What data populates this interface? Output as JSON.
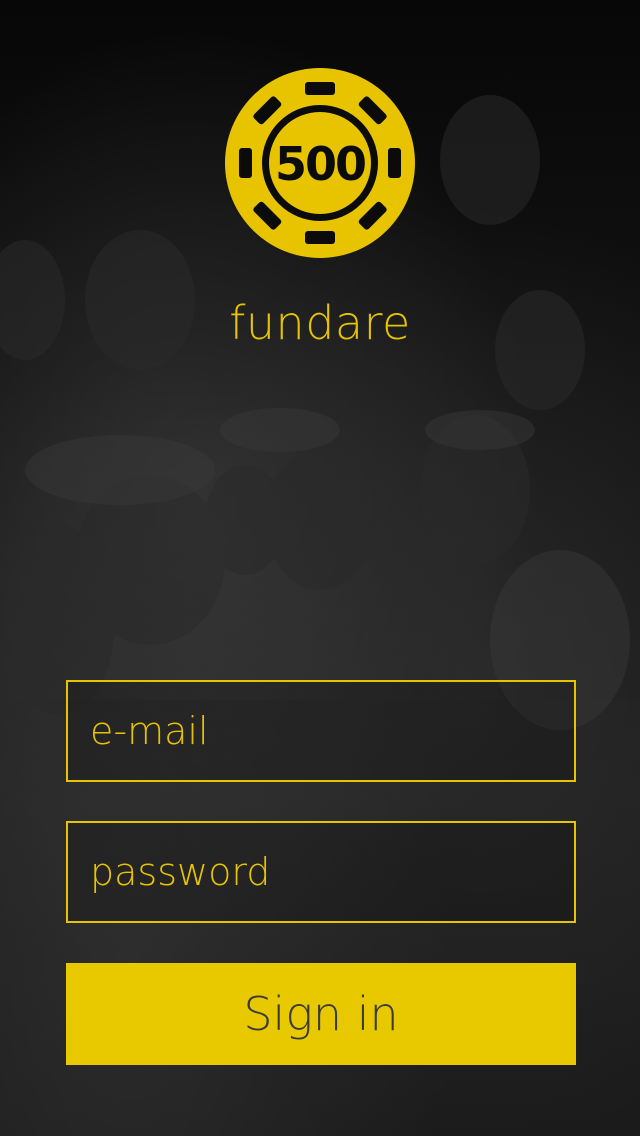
{
  "app": {
    "logo_value": "500",
    "brand_name": "fundare"
  },
  "form": {
    "email_placeholder": "e-mail",
    "email_value": "",
    "password_placeholder": "password",
    "password_value": "",
    "signin_label": "Sign in"
  },
  "colors": {
    "accent": "#e8c400",
    "button_text": "#3a3a3a",
    "background": "#0b0b0b"
  },
  "icons": {
    "logo": "poker-chip-icon"
  }
}
